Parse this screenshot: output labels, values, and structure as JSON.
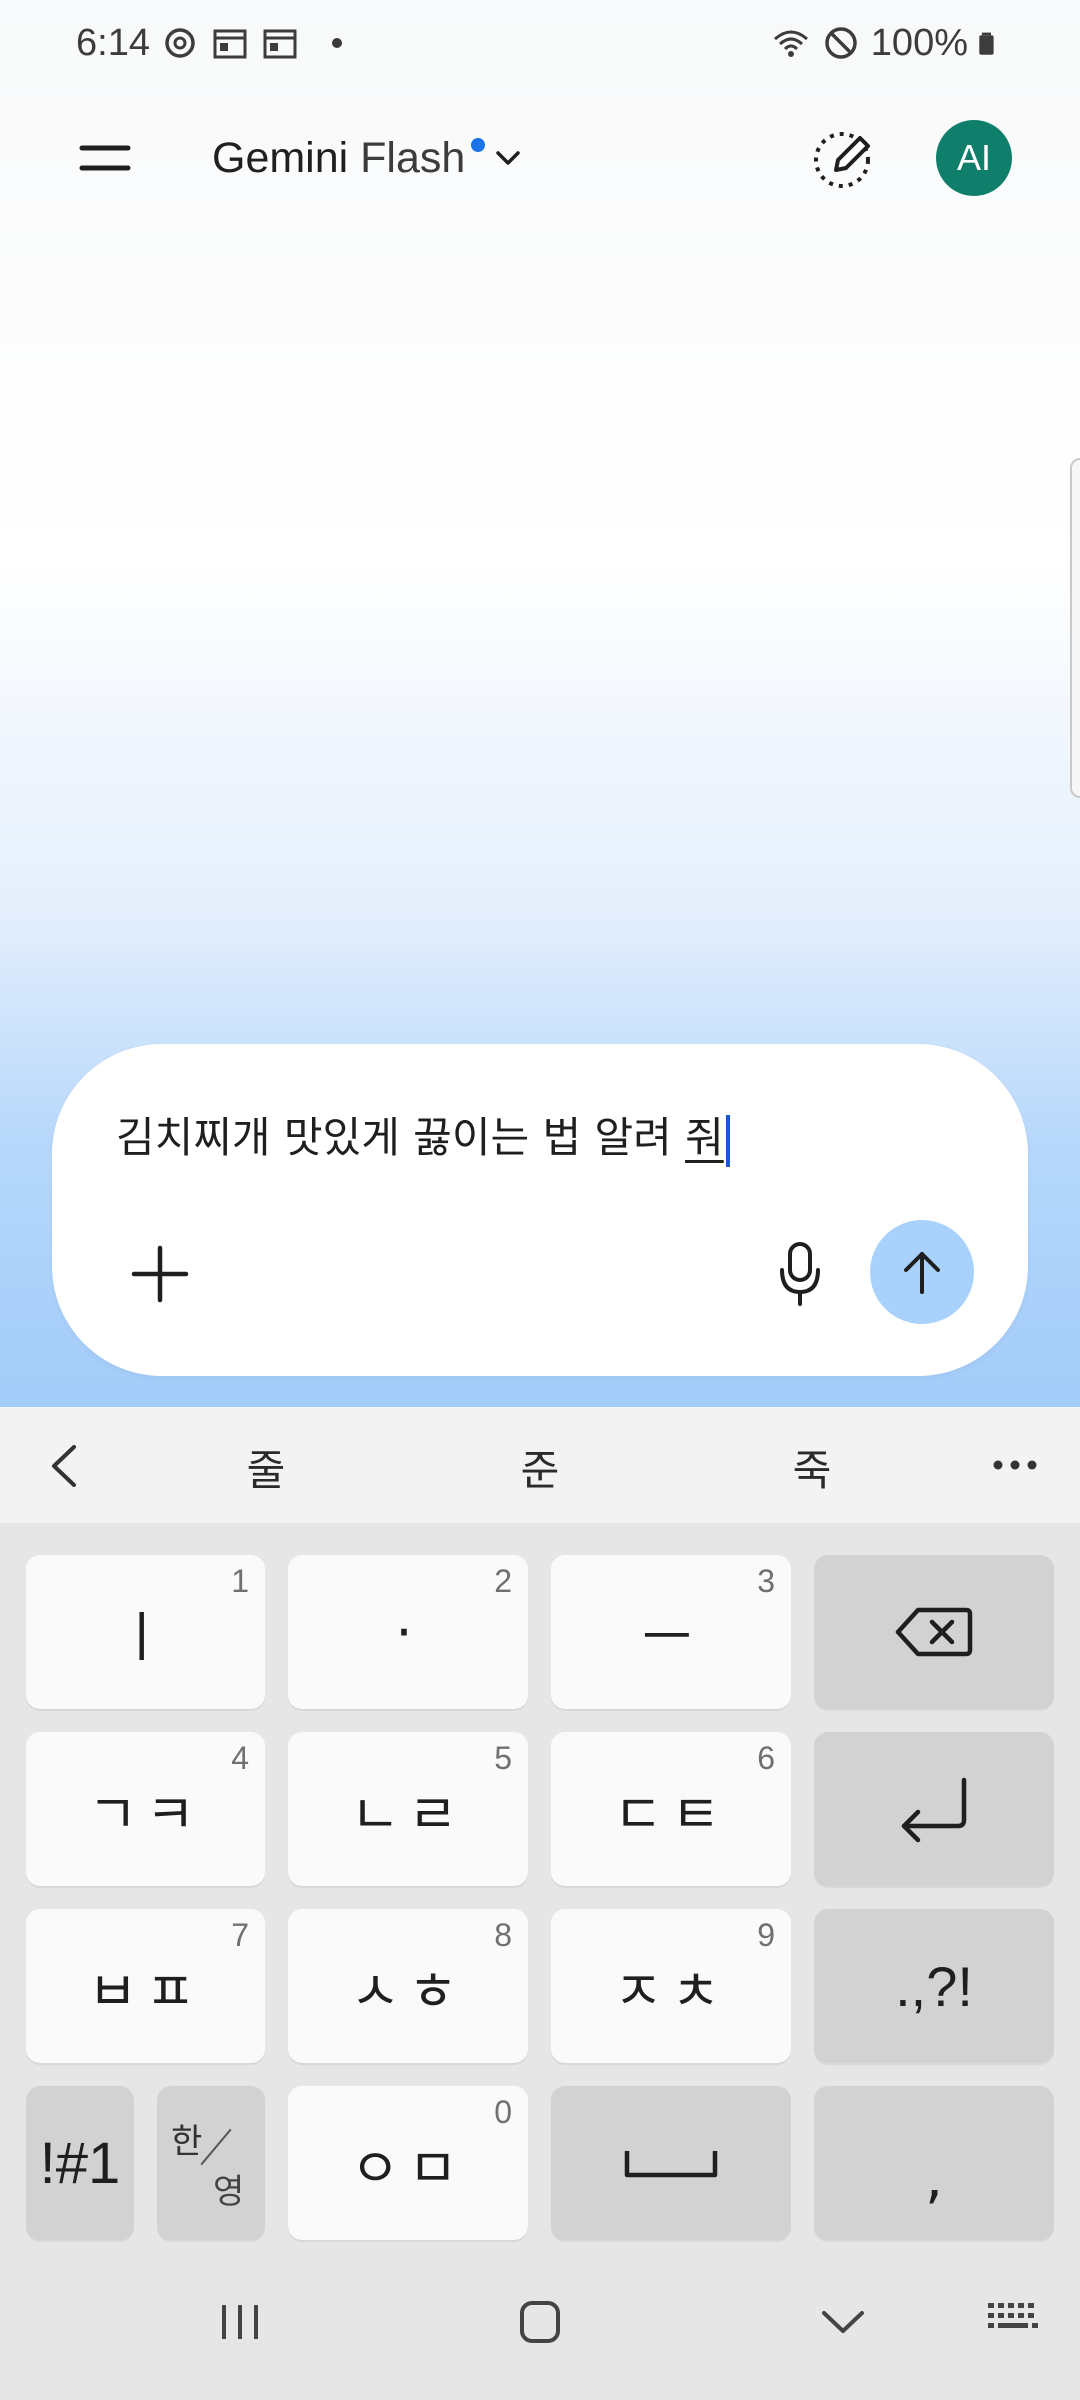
{
  "status_bar": {
    "time": "6:14",
    "battery": "100%",
    "icons": [
      "sync-icon",
      "calendar-icon",
      "calendar-icon",
      "wifi-icon",
      "do-not-disturb-icon",
      "battery-icon"
    ]
  },
  "header": {
    "model_name": "Gemini",
    "model_variant": "Flash",
    "avatar_initials": "AI",
    "icons": [
      "menu-icon",
      "chevron-down-icon",
      "new-chat-icon"
    ]
  },
  "input": {
    "text": "김치찌개 맛있게 끓이는 법 알려 ",
    "composing_text": "줘",
    "icons": [
      "plus-icon",
      "mic-icon",
      "send-arrow-icon"
    ]
  },
  "keyboard": {
    "suggestions": [
      "줄",
      "준",
      "죽"
    ],
    "keys": [
      {
        "label": "ㅣ",
        "num": "1"
      },
      {
        "label": "·",
        "num": "2"
      },
      {
        "label": "ㅡ",
        "num": "3"
      },
      {
        "label": "ㄱㅋ",
        "num": "4"
      },
      {
        "label": "ㄴㄹ",
        "num": "5"
      },
      {
        "label": "ㄷㅌ",
        "num": "6"
      },
      {
        "label": "ㅂㅍ",
        "num": "7"
      },
      {
        "label": "ㅅㅎ",
        "num": "8"
      },
      {
        "label": "ㅈㅊ",
        "num": "9"
      },
      {
        "label": "ㅇㅁ",
        "num": "0"
      }
    ],
    "punct_key": ".,?!",
    "symbols_key": "!#1",
    "lang_han": "한",
    "lang_yeong": "영",
    "comma_key": ","
  },
  "colors": {
    "accent": "#1a73e8",
    "avatar_bg": "#0f7f6c",
    "send_bg": "#a8d1fb",
    "keyboard_bg": "#e6e6e6"
  }
}
